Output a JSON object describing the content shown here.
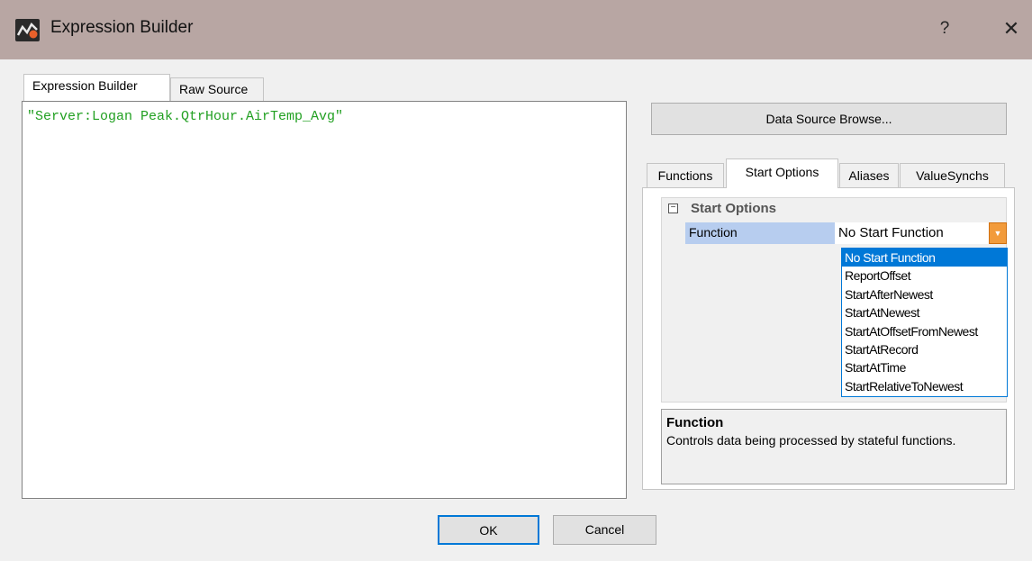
{
  "window": {
    "title": "Expression Builder",
    "help_label": "?",
    "close_label": "✕"
  },
  "left_tabs": [
    {
      "label": "Expression Builder",
      "active": true
    },
    {
      "label": "Raw Source",
      "active": false
    }
  ],
  "editor": {
    "content": "\"Server:Logan Peak.QtrHour.AirTemp_Avg\"",
    "text_color": "#22a022"
  },
  "data_source_button": "Data Source Browse...",
  "right_tabs": [
    {
      "label": "Functions",
      "active": false
    },
    {
      "label": "Start Options",
      "active": true
    },
    {
      "label": "Aliases",
      "active": false
    },
    {
      "label": "ValueSynchs",
      "active": false
    }
  ],
  "property_grid": {
    "category": "Start Options",
    "category_toggle": "−",
    "property_name": "Function",
    "property_value": "No Start Function",
    "dropdown_options": [
      "No Start Function",
      "ReportOffset",
      "StartAfterNewest",
      "StartAtNewest",
      "StartAtOffsetFromNewest",
      "StartAtRecord",
      "StartAtTime",
      "StartRelativeToNewest"
    ],
    "selected_option": "No Start Function"
  },
  "description": {
    "title": "Function",
    "body": "Controls data being processed by stateful functions."
  },
  "buttons": {
    "ok": "OK",
    "cancel": "Cancel"
  },
  "colors": {
    "titlebar": "#b8a6a3",
    "accent": "#0078d7",
    "dropdown_arrow": "#f29b3b",
    "selected_property": "#b7cdef"
  }
}
